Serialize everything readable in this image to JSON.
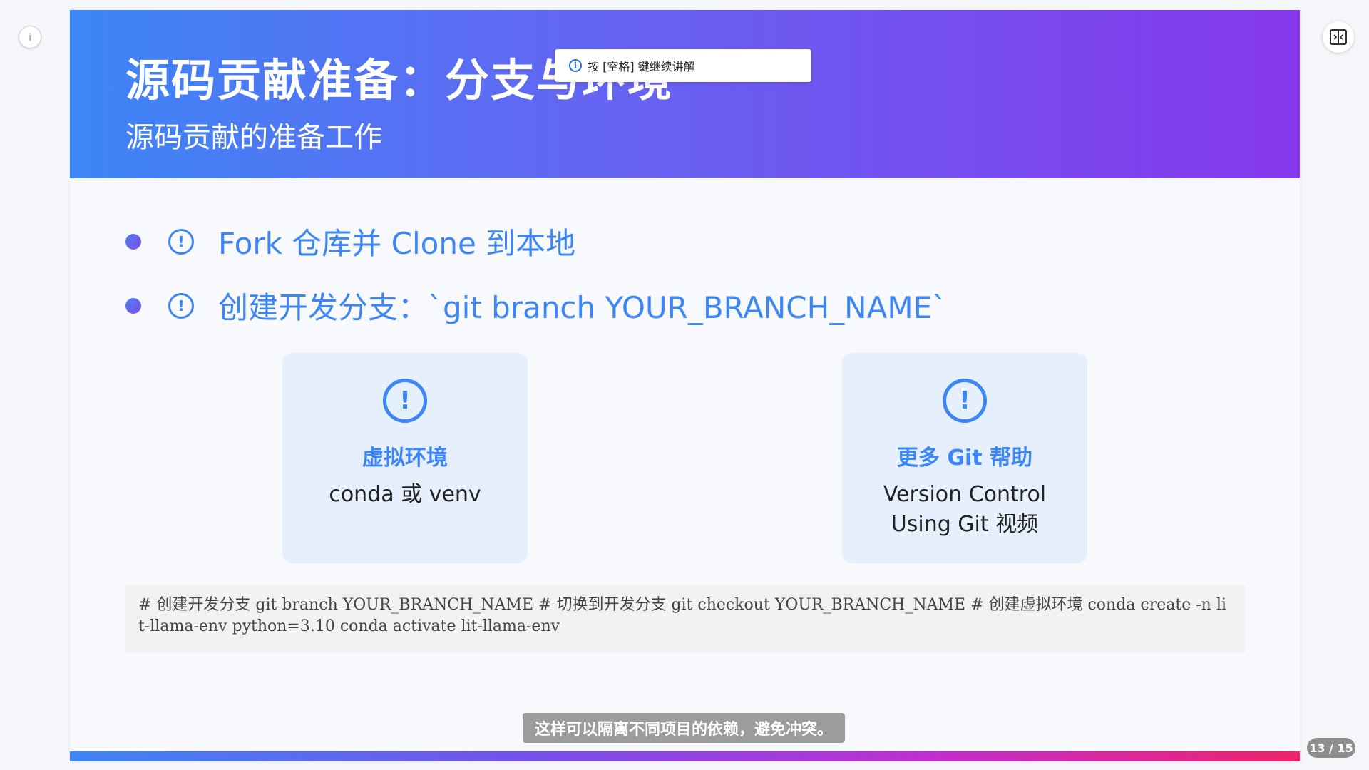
{
  "header": {
    "title": "源码贡献准备：分支与环境",
    "subtitle": "源码贡献的准备工作"
  },
  "hint": {
    "text": "按 [空格] 键继续讲解"
  },
  "bullets": [
    {
      "text": "Fork 仓库并 Clone 到本地"
    },
    {
      "text": "创建开发分支：`git branch YOUR_BRANCH_NAME`"
    }
  ],
  "cards": [
    {
      "title": "虚拟环境",
      "body_lines": [
        "conda 或 venv"
      ]
    },
    {
      "title": "更多 Git 帮助",
      "body_lines": [
        "Version Control",
        "Using Git 视频"
      ]
    }
  ],
  "code": {
    "text": "# 创建开发分支 git branch YOUR_BRANCH_NAME # 切换到开发分支 git checkout YOUR_BRANCH_NAME # 创建虚拟环境 conda create -n lit-llama-env python=3.10 conda activate lit-llama-env"
  },
  "caption": {
    "text": "这样可以隔离不同项目的依赖，避免冲突。"
  },
  "page": {
    "indicator": "13 / 15"
  },
  "icons": {
    "info": "info-icon",
    "split": "split-view-icon",
    "alert": "exclamation-circle-icon"
  },
  "colors": {
    "accent": "#3d86f6",
    "header_start": "#3d86f6",
    "header_end": "#8638ea",
    "card_bg": "#e6effc"
  }
}
